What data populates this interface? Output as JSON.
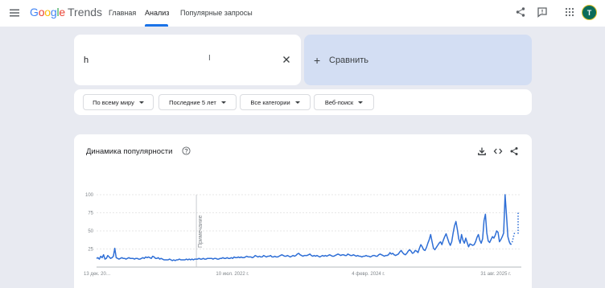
{
  "header": {
    "logo_google": "Google",
    "logo_trends": "Trends",
    "tabs": [
      {
        "label": "Главная"
      },
      {
        "label": "Анализ"
      },
      {
        "label": "Популярные запросы"
      }
    ],
    "avatar_letter": "T"
  },
  "search": {
    "term_value": "h"
  },
  "compare": {
    "plus": "+",
    "label": "Сравнить"
  },
  "filters": [
    {
      "label": "По всему миру"
    },
    {
      "label": "Последние 5 лет"
    },
    {
      "label": "Все категории"
    },
    {
      "label": "Веб-поиск"
    }
  ],
  "chart_card": {
    "title": "Динамика популярности",
    "icons": [
      "help-icon",
      "download-icon",
      "embed-code-icon",
      "share-icon"
    ]
  },
  "chart_data": {
    "type": "line",
    "title": "Динамика популярности",
    "xlabel": "",
    "ylabel": "",
    "ylim": [
      0,
      100
    ],
    "yticks": [
      "100",
      "75",
      "50",
      "25"
    ],
    "x_tick_labels": [
      "13 дек. 20…",
      "10 июл. 2022 г.",
      "4 февр. 2024 г.",
      "31 авг. 2025 г."
    ],
    "annotation": "Примечание",
    "series_color": "#2f6fd6",
    "grid": true,
    "values": [
      12,
      13,
      11,
      15,
      13,
      17,
      11,
      12,
      16,
      14,
      12,
      13,
      15,
      26,
      13,
      12,
      11,
      12,
      13,
      12,
      12,
      11,
      12,
      13,
      12,
      12,
      12,
      11,
      12,
      12,
      11,
      11,
      12,
      13,
      12,
      14,
      13,
      14,
      13,
      12,
      15,
      14,
      12,
      12,
      13,
      11,
      12,
      11,
      10,
      10,
      10,
      10,
      11,
      10,
      9,
      10,
      9,
      10,
      10,
      11,
      10,
      10,
      10,
      10,
      11,
      10,
      11,
      10,
      11,
      10,
      11,
      11,
      11,
      12,
      11,
      11,
      12,
      11,
      11,
      12,
      12,
      12,
      12,
      11,
      12,
      12,
      11,
      11,
      12,
      12,
      13,
      12,
      12,
      13,
      12,
      12,
      13,
      12,
      14,
      13,
      13,
      14,
      13,
      14,
      13,
      13,
      14,
      15,
      14,
      14,
      14,
      13,
      14,
      16,
      15,
      14,
      15,
      14,
      14,
      16,
      15,
      14,
      15,
      15,
      16,
      14,
      14,
      15,
      14,
      14,
      15,
      16,
      17,
      16,
      15,
      15,
      16,
      15,
      14,
      15,
      16,
      15,
      16,
      18,
      19,
      17,
      16,
      15,
      16,
      16,
      16,
      17,
      18,
      16,
      15,
      16,
      15,
      16,
      15,
      14,
      15,
      16,
      15,
      16,
      15,
      16,
      17,
      16,
      15,
      15,
      16,
      17,
      18,
      17,
      16,
      17,
      17,
      16,
      16,
      18,
      17,
      16,
      16,
      17,
      16,
      15,
      16,
      15,
      15,
      14,
      15,
      15,
      16,
      15,
      15,
      14,
      15,
      16,
      16,
      15,
      15,
      17,
      18,
      17,
      16,
      15,
      16,
      16,
      17,
      20,
      18,
      19,
      17,
      16,
      17,
      18,
      21,
      23,
      20,
      18,
      17,
      19,
      22,
      24,
      22,
      19,
      20,
      23,
      22,
      20,
      26,
      31,
      28,
      24,
      23,
      27,
      33,
      38,
      45,
      35,
      26,
      24,
      27,
      30,
      33,
      35,
      31,
      37,
      42,
      46,
      40,
      34,
      30,
      35,
      47,
      57,
      63,
      52,
      39,
      33,
      45,
      37,
      33,
      40,
      34,
      28,
      32,
      31,
      30,
      31,
      35,
      41,
      45,
      37,
      33,
      39,
      64,
      73,
      47,
      36,
      34,
      38,
      42,
      40,
      44,
      50,
      48,
      35,
      38,
      42,
      47,
      100,
      72,
      42,
      35,
      31,
      34,
      42,
      49
    ]
  }
}
